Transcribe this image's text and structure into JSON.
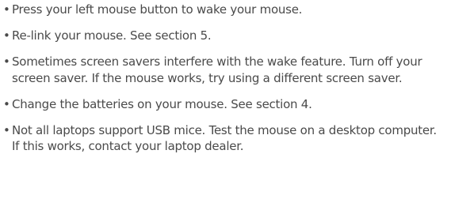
{
  "bullet_glyph": "•",
  "items": [
    {
      "text": "Press your left mouse button to wake your mouse."
    },
    {
      "text": "Re-link your mouse. See section 5."
    },
    {
      "text": "Sometimes screen savers interfere with the wake feature. Turn off your screen saver. If the mouse works, try using a different screen saver."
    },
    {
      "text": "Change the batteries on your mouse. See section 4."
    },
    {
      "text": "Not all laptops support USB mice. Test the mouse on a desktop computer. If this works, contact your laptop dealer."
    }
  ],
  "colors": {
    "text": "#4a4a4a",
    "background": "#ffffff"
  }
}
